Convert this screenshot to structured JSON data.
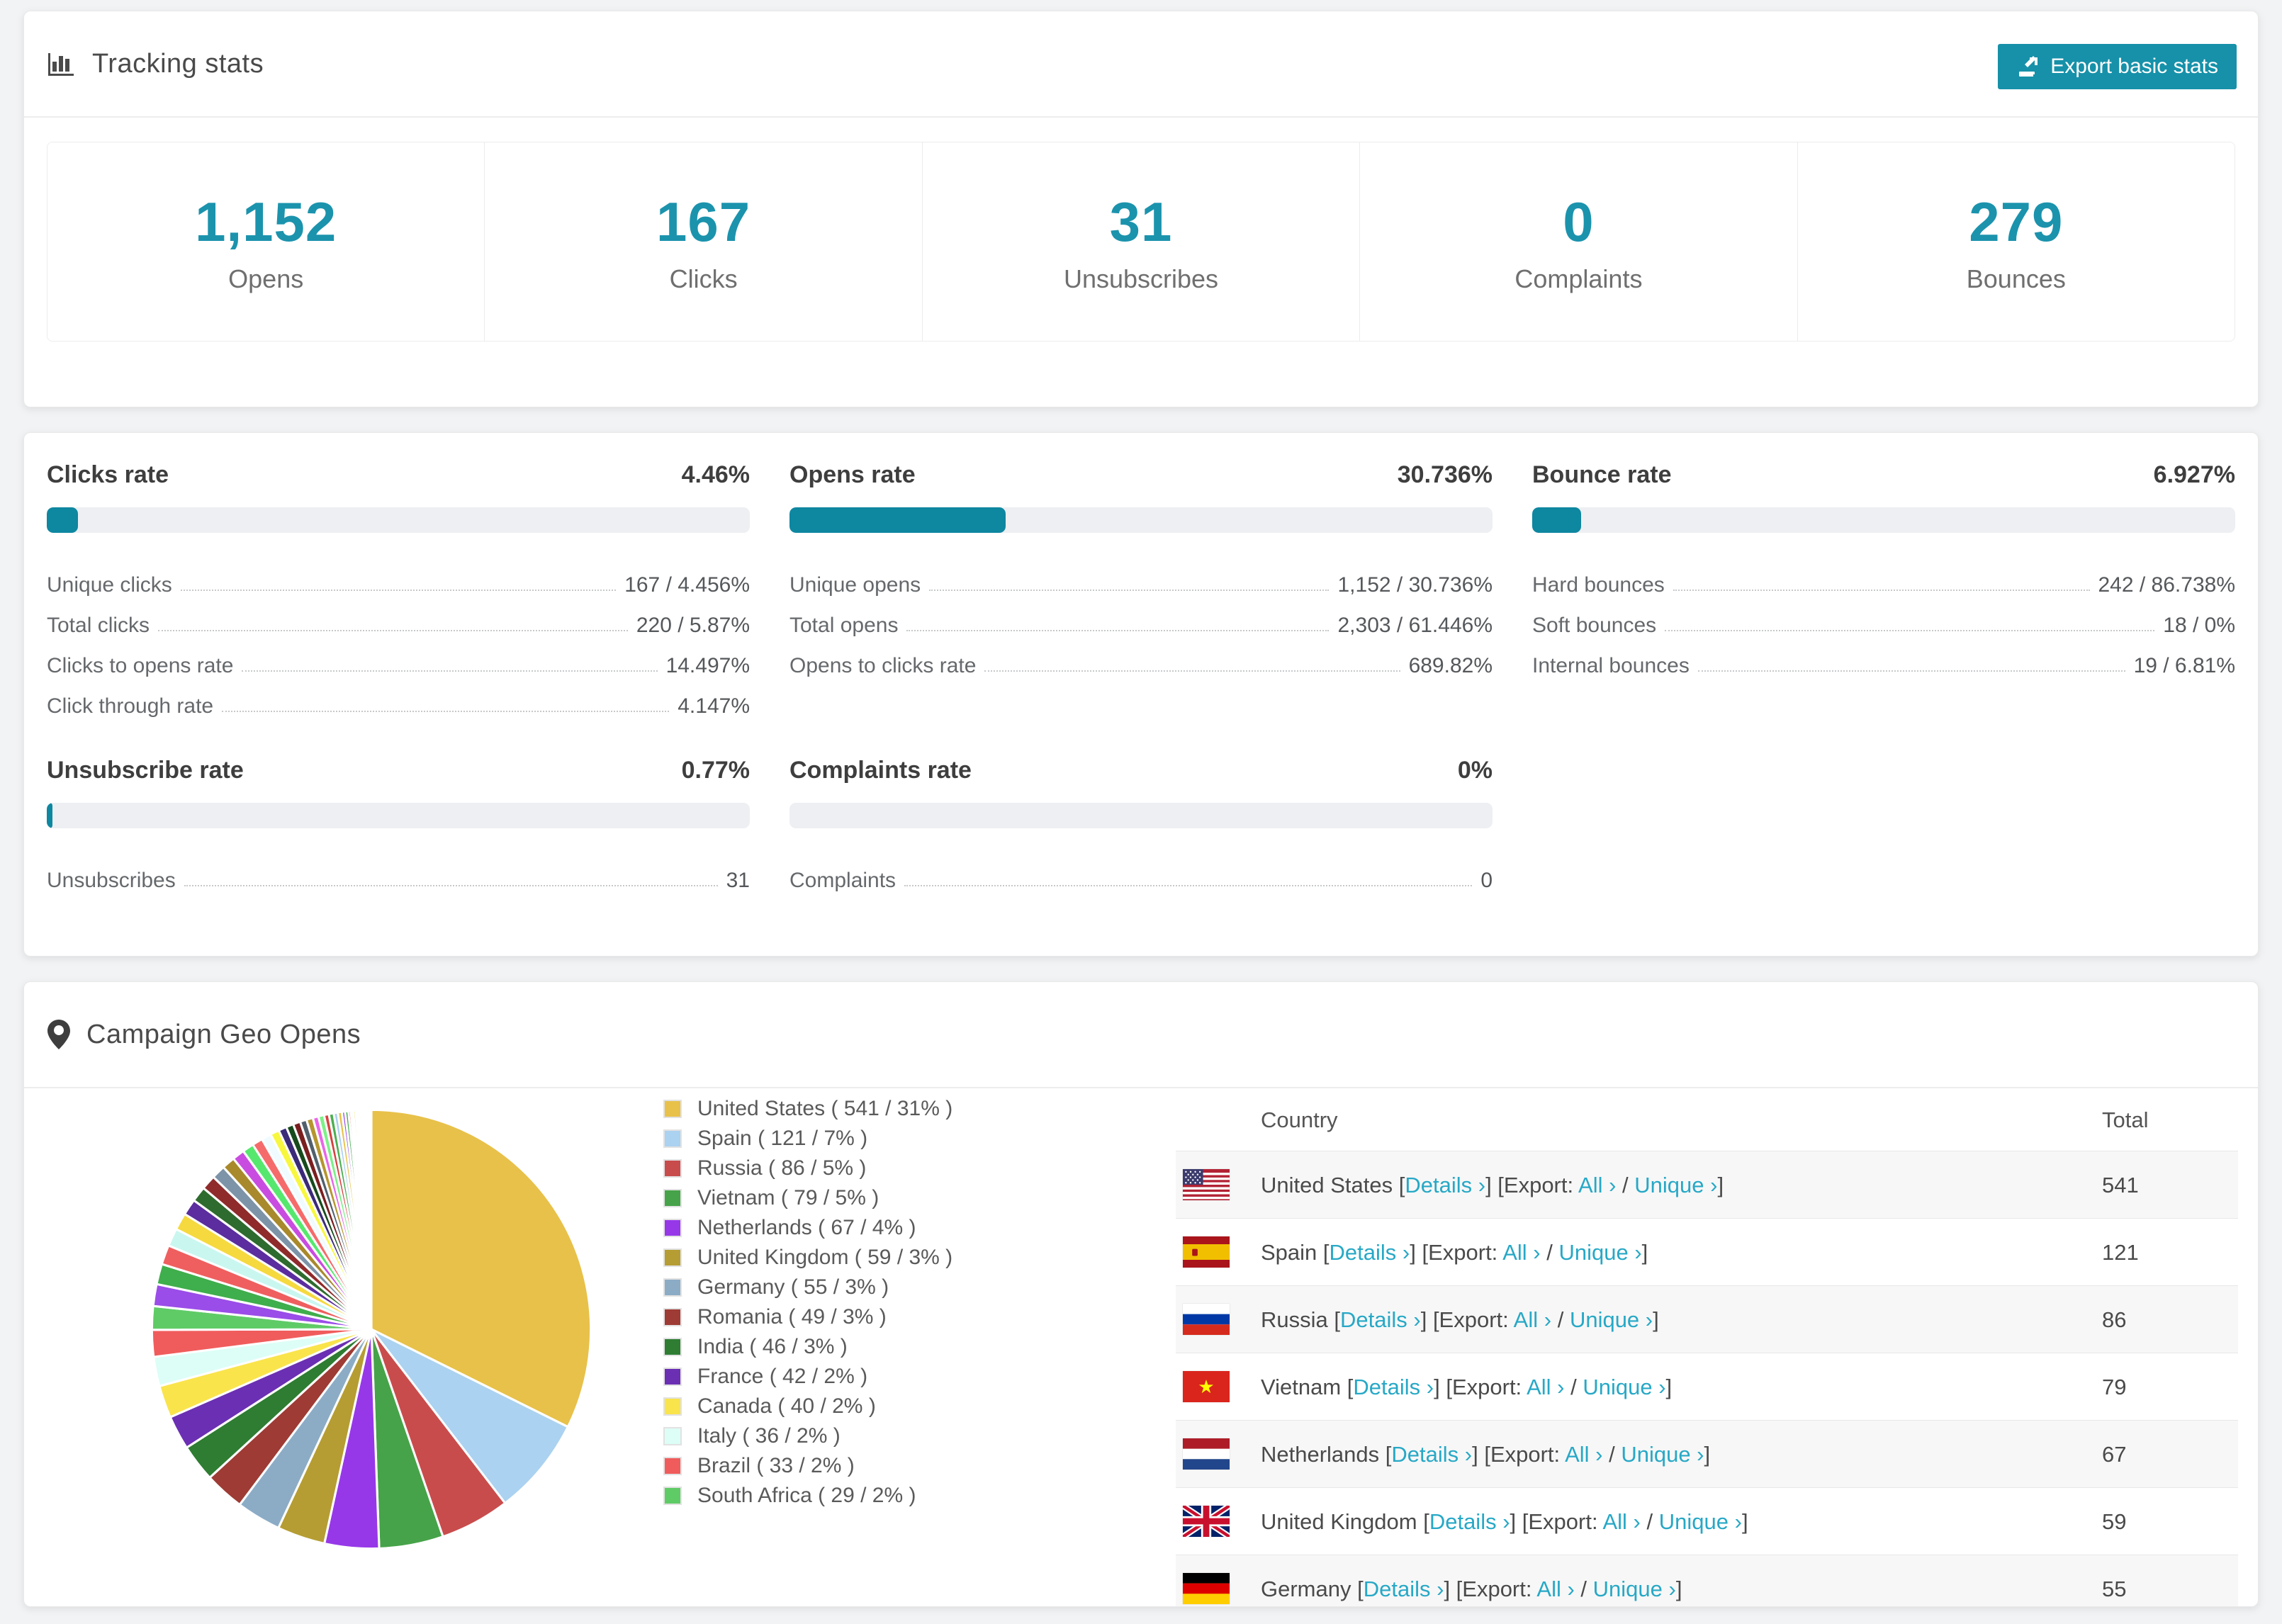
{
  "colors": {
    "accent": "#1691a9",
    "progress_fill": "#0e87a0",
    "link": "#27a8c6",
    "stat_number": "#1b93ad"
  },
  "tracking": {
    "title": "Tracking stats",
    "export_label": "Export basic stats",
    "stats": [
      {
        "value": "1,152",
        "label": "Opens"
      },
      {
        "value": "167",
        "label": "Clicks"
      },
      {
        "value": "31",
        "label": "Unsubscribes"
      },
      {
        "value": "0",
        "label": "Complaints"
      },
      {
        "value": "279",
        "label": "Bounces"
      }
    ]
  },
  "rates": [
    {
      "title": "Clicks rate",
      "value": "4.46%",
      "percent": 4.46,
      "rows": [
        {
          "label": "Unique clicks",
          "value": "167 / 4.456%"
        },
        {
          "label": "Total clicks",
          "value": "220 / 5.87%"
        },
        {
          "label": "Clicks to opens rate",
          "value": "14.497%"
        },
        {
          "label": "Click through rate",
          "value": "4.147%"
        }
      ]
    },
    {
      "title": "Opens rate",
      "value": "30.736%",
      "percent": 30.736,
      "rows": [
        {
          "label": "Unique opens",
          "value": "1,152 / 30.736%"
        },
        {
          "label": "Total opens",
          "value": "2,303 / 61.446%"
        },
        {
          "label": "Opens to clicks rate",
          "value": "689.82%"
        }
      ]
    },
    {
      "title": "Bounce rate",
      "value": "6.927%",
      "percent": 6.927,
      "rows": [
        {
          "label": "Hard bounces",
          "value": "242 / 86.738%"
        },
        {
          "label": "Soft bounces",
          "value": "18 / 0%"
        },
        {
          "label": "Internal bounces",
          "value": "19 / 6.81%"
        }
      ]
    },
    {
      "title": "Unsubscribe rate",
      "value": "0.77%",
      "percent": 0.77,
      "rows": [
        {
          "label": "Unsubscribes",
          "value": "31"
        }
      ]
    },
    {
      "title": "Complaints rate",
      "value": "0%",
      "percent": 0,
      "rows": [
        {
          "label": "Complaints",
          "value": "0"
        }
      ]
    }
  ],
  "geo": {
    "title": "Campaign Geo Opens",
    "legend_items": [
      "United States ( 541 / 31% )",
      "Spain ( 121 / 7% )",
      "Russia ( 86 / 5% )",
      "Vietnam ( 79 / 5% )",
      "Netherlands ( 67 / 4% )",
      "United Kingdom ( 59 / 3% )",
      "Germany ( 55 / 3% )",
      "Romania ( 49 / 3% )",
      "India ( 46 / 3% )",
      "France ( 42 / 2% )",
      "Canada ( 40 / 2% )",
      "Italy ( 36 / 2% )",
      "Brazil ( 33 / 2% )",
      "South Africa ( 29 / 2% )"
    ],
    "table": {
      "headers": [
        "Country",
        "Total"
      ],
      "tok": {
        "open": "[",
        "details": "Details ›",
        "close_open_export": "] [Export:",
        "all": "All ›",
        "slash": "/",
        "unique": "Unique ›",
        "close": "]"
      },
      "rows": [
        {
          "country": "United States",
          "total": "541"
        },
        {
          "country": "Spain",
          "total": "121"
        },
        {
          "country": "Russia",
          "total": "86"
        },
        {
          "country": "Vietnam",
          "total": "79"
        },
        {
          "country": "Netherlands",
          "total": "67"
        },
        {
          "country": "United Kingdom",
          "total": "59"
        },
        {
          "country": "Germany",
          "total": "55"
        }
      ]
    }
  },
  "chart_data": {
    "type": "pie",
    "title": "Campaign Geo Opens",
    "legend_position": "right",
    "start_angle_deg": -90,
    "direction": "clockwise",
    "slices": [
      {
        "label": "United States",
        "value": 541,
        "pct": 31,
        "color": "#e8c14a"
      },
      {
        "label": "Spain",
        "value": 121,
        "pct": 7,
        "color": "#abd2f0"
      },
      {
        "label": "Russia",
        "value": 86,
        "pct": 5,
        "color": "#c94c4c"
      },
      {
        "label": "Vietnam",
        "value": 79,
        "pct": 5,
        "color": "#46a349"
      },
      {
        "label": "Netherlands",
        "value": 67,
        "pct": 4,
        "color": "#9638e8"
      },
      {
        "label": "United Kingdom",
        "value": 59,
        "pct": 3,
        "color": "#b59d33"
      },
      {
        "label": "Germany",
        "value": 55,
        "pct": 3,
        "color": "#8cacc6"
      },
      {
        "label": "Romania",
        "value": 49,
        "pct": 3,
        "color": "#9e3b34"
      },
      {
        "label": "India",
        "value": 46,
        "pct": 3,
        "color": "#2e7d32"
      },
      {
        "label": "France",
        "value": 42,
        "pct": 2,
        "color": "#6b2fb3"
      },
      {
        "label": "Canada",
        "value": 40,
        "pct": 2,
        "color": "#f9e44c"
      },
      {
        "label": "Italy",
        "value": 36,
        "pct": 2,
        "color": "#dcfef6"
      },
      {
        "label": "Brazil",
        "value": 33,
        "pct": 2,
        "color": "#f05c5c"
      },
      {
        "label": "South Africa",
        "value": 29,
        "pct": 2,
        "color": "#5fcb66"
      }
    ],
    "other_values": [
      27,
      25,
      24,
      22,
      21,
      20,
      19,
      18,
      17,
      16,
      15,
      14,
      13,
      12,
      11,
      10,
      9,
      9,
      8,
      8,
      7,
      7,
      6,
      6,
      5,
      5,
      4,
      4,
      3,
      3,
      3,
      2,
      2,
      2,
      2,
      1,
      1,
      1,
      1,
      1,
      1,
      1,
      1,
      1,
      1,
      1
    ],
    "other_palette": [
      "#9a4de8",
      "#3fae4c",
      "#ef5f5f",
      "#c9f7f0",
      "#f5d93f",
      "#5b2d9e",
      "#2e6b2e",
      "#8f2b2b",
      "#7d93a8",
      "#a8892b",
      "#c94ce0",
      "#56e86e",
      "#f56b6b",
      "#f0fbff",
      "#f7f73f",
      "#3b2a78",
      "#174a1c",
      "#7a1f1f",
      "#51606c",
      "#b5952e",
      "#e866e8",
      "#7cf087",
      "#d4423e",
      "#4caf50",
      "#a8cff0",
      "#e8c14a"
    ]
  }
}
